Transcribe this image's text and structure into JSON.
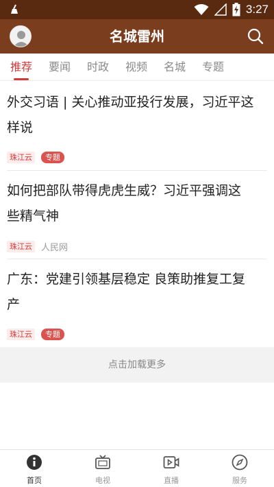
{
  "status_bar": {
    "time": "3:27"
  },
  "header": {
    "title": "名城雷州"
  },
  "tabs": [
    {
      "label": "推荐"
    },
    {
      "label": "要闻"
    },
    {
      "label": "时政"
    },
    {
      "label": "视频"
    },
    {
      "label": "名城"
    },
    {
      "label": "专题"
    }
  ],
  "news": [
    {
      "line1": "外交习语 | 关心推动亚投行发展，习近平这",
      "line2": "样说",
      "source": "珠江云",
      "extra": "专题"
    },
    {
      "line1": "如何把部队带得虎虎生威？习近平强调这",
      "line2": "些精气神",
      "source": "珠江云",
      "extra": "人民网"
    },
    {
      "line1": "广东：党建引领基层稳定 良策助推复工复",
      "line2": "产",
      "source": "珠江云",
      "extra": "专题"
    }
  ],
  "load_more": "点击加载更多",
  "bottom_nav": [
    {
      "label": "首页",
      "icon": "info-icon"
    },
    {
      "label": "电视",
      "icon": "tv-icon"
    },
    {
      "label": "直播",
      "icon": "live-video-icon"
    },
    {
      "label": "服务",
      "icon": "compass-icon"
    }
  ]
}
